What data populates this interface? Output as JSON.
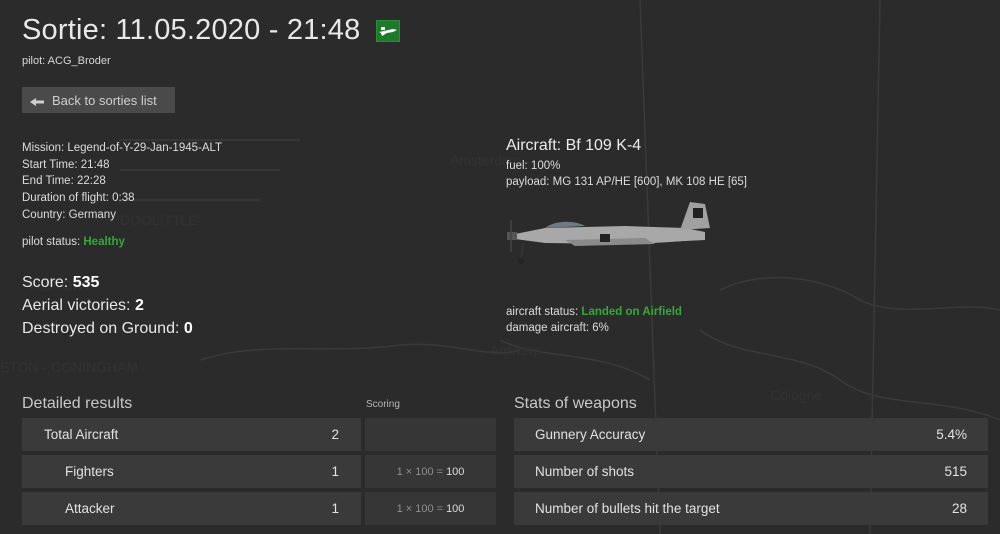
{
  "header": {
    "title": "Sortie: 11.05.2020 - 21:48",
    "pilot": "pilot: ACG_Broder",
    "back_label": "Back to sorties list"
  },
  "mission": {
    "mission": "Mission: Legend-of-Y-29-Jan-1945-ALT",
    "start": "Start Time: 21:48",
    "end": "End Time: 22:28",
    "duration": "Duration of flight: 0:38",
    "country": "Country: Germany",
    "pilot_status_label": "pilot status:",
    "pilot_status_value": "Healthy"
  },
  "summary": {
    "score_label": "Score:",
    "score_value": "535",
    "aerial_label": "Aerial victories:",
    "aerial_value": "2",
    "ground_label": "Destroyed on Ground:",
    "ground_value": "0"
  },
  "aircraft": {
    "title": "Aircraft: Bf 109 K-4",
    "fuel": "fuel: 100%",
    "payload": "payload: MG 131 AP/HE [600], MK 108 HE [65]",
    "status_label": "aircraft status:",
    "status_value": "Landed on Airfield",
    "damage": "damage aircraft: 6%"
  },
  "detailed": {
    "title": "Detailed results",
    "scoring_header": "Scoring",
    "rows": [
      {
        "label": "Total Aircraft",
        "count": "2",
        "formula": "",
        "points": ""
      },
      {
        "label": "Fighters",
        "count": "1",
        "formula": "1 × 100 =",
        "points": "100"
      },
      {
        "label": "Attacker",
        "count": "1",
        "formula": "1 × 100 =",
        "points": "100"
      }
    ]
  },
  "weapons": {
    "title": "Stats of weapons",
    "rows": [
      {
        "label": "Gunnery Accuracy",
        "value": "5.4%"
      },
      {
        "label": "Number of shots",
        "value": "515"
      },
      {
        "label": "Number of bullets hit the target",
        "value": "28"
      }
    ]
  },
  "icons": {
    "back": "arrow-left-icon",
    "flag": "luftwaffe-plane-flag-icon"
  },
  "colors": {
    "background": "#2b2b2b",
    "status_green": "#34a83a",
    "panel": "#3a3a3a",
    "flag_green": "#1d7a2a"
  }
}
